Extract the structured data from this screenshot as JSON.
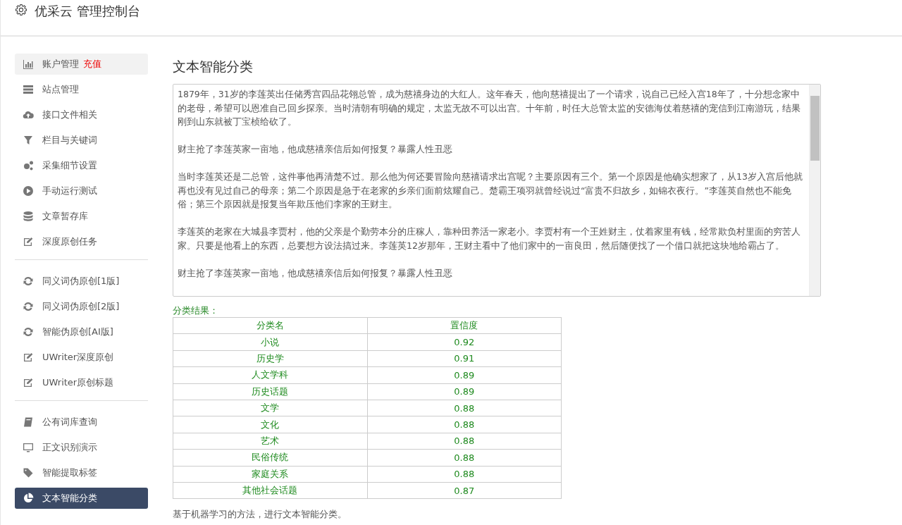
{
  "header": {
    "title": "优采云 管理控制台"
  },
  "sidebar": {
    "groups": [
      {
        "items": [
          {
            "label": "账户管理",
            "badge": "充值",
            "hovered": true,
            "selected": false
          },
          {
            "label": "站点管理",
            "hovered": false,
            "selected": false
          },
          {
            "label": "接口文件相关",
            "hovered": false,
            "selected": false
          },
          {
            "label": "栏目与关键词",
            "hovered": false,
            "selected": false
          },
          {
            "label": "采集细节设置",
            "hovered": false,
            "selected": false
          },
          {
            "label": "手动运行测试",
            "hovered": false,
            "selected": false
          },
          {
            "label": "文章暂存库",
            "hovered": false,
            "selected": false
          },
          {
            "label": "深度原创任务",
            "hovered": false,
            "selected": false
          }
        ]
      },
      {
        "items": [
          {
            "label": "同义词伪原创[1版]",
            "hovered": false,
            "selected": false
          },
          {
            "label": "同义词伪原创[2版]",
            "hovered": false,
            "selected": false
          },
          {
            "label": "智能伪原创[AI版]",
            "hovered": false,
            "selected": false
          },
          {
            "label": "UWriter深度原创",
            "hovered": false,
            "selected": false
          },
          {
            "label": "UWriter原创标题",
            "hovered": false,
            "selected": false
          }
        ]
      },
      {
        "items": [
          {
            "label": "公有词库查询",
            "hovered": false,
            "selected": false
          },
          {
            "label": "正文识别演示",
            "hovered": false,
            "selected": false
          },
          {
            "label": "智能提取标签",
            "hovered": false,
            "selected": false
          },
          {
            "label": "文本智能分类",
            "hovered": false,
            "selected": true
          }
        ]
      }
    ]
  },
  "main": {
    "title": "文本智能分类",
    "text_input": {
      "paragraphs": [
        "1879年，31岁的李莲英出任储秀宫四品花翎总管，成为慈禧身边的大红人。这年春天，他向慈禧提出了一个请求，说自己已经入宫18年了，十分想念家中的老母，希望可以恩准自己回乡探亲。当时清朝有明确的规定，太监无故不可以出宫。十年前，时任大总管太监的安德海仗着慈禧的宠信到江南游玩，结果刚到山东就被丁宝桢给砍了。",
        "财主抢了李莲英家一亩地，他成慈禧亲信后如何报复？暴露人性丑恶",
        "当时李莲英还是二总管，这件事他再清楚不过。那么他为何还要冒险向慈禧请求出宫呢？主要原因有三个。第一个原因是他确实想家了，从13岁入宫后他就再也没有见过自己的母亲；第二个原因是急于在老家的乡亲们面前炫耀自己。楚霸王项羽就曾经说过“富贵不归故乡，如锦衣夜行。”李莲英自然也不能免俗；第三个原因就是报复当年欺压他们李家的王财主。",
        "李莲英的老家在大城县李贾村，他的父亲是个勤劳本分的庄稼人，靠种田养活一家老小。李贾村有一个王姓财主，仗着家里有钱，经常欺负村里面的穷苦人家。只要是他看上的东西，总要想方设法搞过来。李莲英12岁那年，王财主看中了他们家中的一亩良田，然后随便找了一个借口就把这块地给霸占了。",
        "财主抢了李莲英家一亩地，他成慈禧亲信后如何报复？暴露人性丑恶"
      ]
    },
    "result_label": "分类结果：",
    "table": {
      "columns": [
        "分类名",
        "置信度"
      ],
      "rows": [
        [
          "小说",
          "0.92"
        ],
        [
          "历史学",
          "0.91"
        ],
        [
          "人文学科",
          "0.89"
        ],
        [
          "历史话题",
          "0.89"
        ],
        [
          "文学",
          "0.88"
        ],
        [
          "文化",
          "0.88"
        ],
        [
          "艺术",
          "0.88"
        ],
        [
          "民俗传统",
          "0.88"
        ],
        [
          "家庭关系",
          "0.88"
        ],
        [
          "其他社会话题",
          "0.87"
        ]
      ]
    },
    "description": "基于机器学习的方法，进行文本智能分类。"
  }
}
